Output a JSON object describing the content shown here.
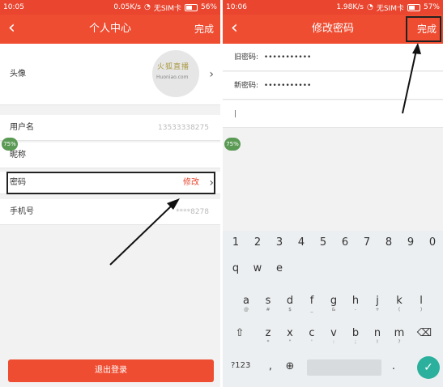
{
  "left": {
    "status": {
      "time": "10:05",
      "speed": "0.05K/s",
      "sim": "无SIM卡",
      "battery": "56%"
    },
    "title": "个人中心",
    "done": "完成",
    "avatar_label": "头像",
    "avatar_logo": "火狐直播",
    "avatar_logo_domain": "Huoniao.com",
    "rows": {
      "username_label": "用户名",
      "username_value": "13533338275",
      "nickname_label": "昵称",
      "password_label": "密码",
      "password_action": "修改",
      "phone_label": "手机号",
      "phone_value": "****8278"
    },
    "bubble": "75%",
    "logout": "退出登录"
  },
  "right": {
    "status": {
      "time": "10:06",
      "speed": "1.98K/s",
      "sim": "无SIM卡",
      "battery": "57%"
    },
    "title": "修改密码",
    "done": "完成",
    "old_label": "旧密码:",
    "old_value": "•••••••••••",
    "new_label": "新密码:",
    "new_value": "•••••••••••",
    "bubble": "75%",
    "keyboard": {
      "numbers": [
        "1",
        "2",
        "3",
        "4",
        "5",
        "6",
        "7",
        "8",
        "9",
        "0"
      ],
      "row1": [
        "q",
        "w",
        "e"
      ],
      "row2": [
        {
          "k": "a",
          "s": "@"
        },
        {
          "k": "s",
          "s": "#"
        },
        {
          "k": "d",
          "s": "$"
        },
        {
          "k": "f",
          "s": "_"
        },
        {
          "k": "g",
          "s": "&"
        },
        {
          "k": "h",
          "s": "-"
        },
        {
          "k": "j",
          "s": "+"
        },
        {
          "k": "k",
          "s": "("
        },
        {
          "k": "l",
          "s": ")"
        }
      ],
      "row3": [
        {
          "k": "z",
          "s": "*"
        },
        {
          "k": "x",
          "s": "\""
        },
        {
          "k": "c",
          "s": "'"
        },
        {
          "k": "v",
          "s": ":"
        },
        {
          "k": "b",
          "s": ";"
        },
        {
          "k": "n",
          "s": "!"
        },
        {
          "k": "m",
          "s": "?"
        }
      ],
      "sym_key": "?123",
      "comma": ",",
      "period": "."
    }
  },
  "colors": {
    "brand_red": "#ef4d32",
    "confirm_teal": "#2bb09d"
  }
}
